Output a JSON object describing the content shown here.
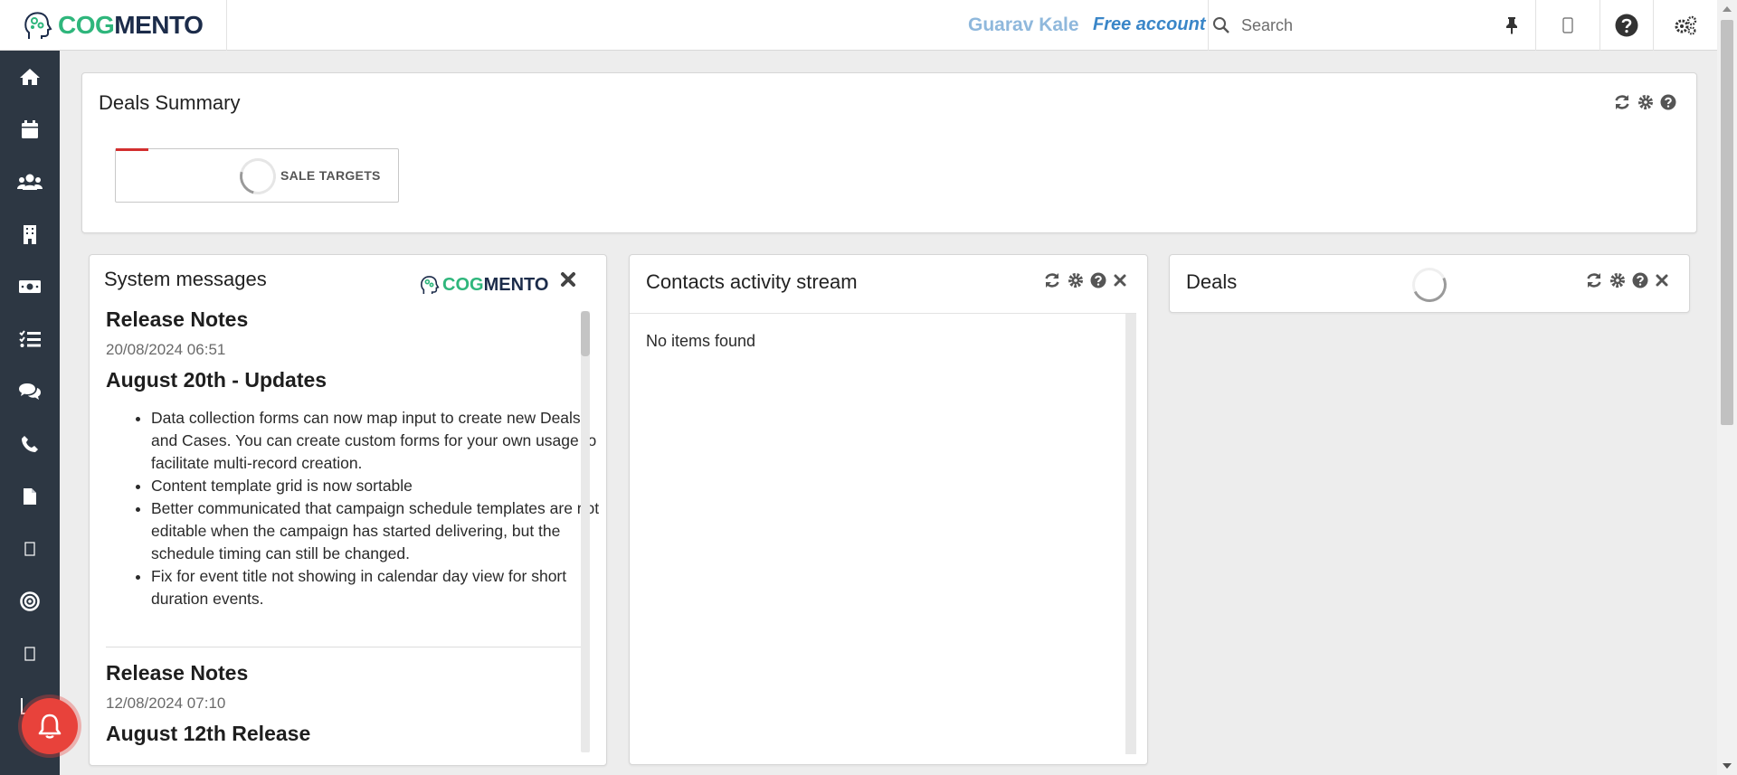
{
  "topbar": {
    "logo_cog": "COG",
    "logo_mento": "MENTO",
    "user_name": "Guarav Kale",
    "account_type": "Free account",
    "search_placeholder": "Search",
    "icons": [
      "pin-icon",
      "mobile-icon",
      "help-icon",
      "settings-gears-icon"
    ]
  },
  "sidebar": {
    "items": [
      "home-icon",
      "calendar-icon",
      "contacts-icon",
      "companies-icon",
      "deals-icon",
      "tasks-icon",
      "cases-icon",
      "calls-icon",
      "documents-icon",
      "email-icon",
      "campaigns-icon",
      "forms-icon",
      "reports-icon"
    ]
  },
  "deals_summary": {
    "title": "Deals Summary",
    "sale_targets_label": "SALE TARGETS",
    "icons": [
      "refresh-icon",
      "settings-icon",
      "help-icon"
    ]
  },
  "system_messages": {
    "title": "System messages",
    "logo_cog": "COG",
    "logo_mento": "MENTO",
    "messages": [
      {
        "title": "Release Notes",
        "date": "20/08/2024 06:51",
        "heading": "August 20th - Updates",
        "items": [
          "Data collection forms can now map input to create new Deals and Cases. You can create custom forms for your own usage to facilitate multi-record creation.",
          "Content template grid is now sortable",
          "Better communicated that campaign schedule templates are not editable when the campaign has started delivering, but the schedule timing can still be changed.",
          "Fix for event title not showing in calendar day view for short duration events."
        ]
      },
      {
        "title": "Release Notes",
        "date": "12/08/2024 07:10",
        "heading": "August 12th Release"
      }
    ]
  },
  "contacts_activity": {
    "title": "Contacts activity stream",
    "empty_text": "No items found",
    "icons": [
      "refresh-icon",
      "settings-icon",
      "help-icon",
      "close-icon"
    ]
  },
  "deals": {
    "title": "Deals",
    "icons": [
      "refresh-icon",
      "settings-icon",
      "help-icon",
      "close-icon"
    ]
  },
  "colors": {
    "sidebar_bg": "#2d3743",
    "brand_green": "#2fb67c",
    "brand_navy": "#1c2c4a",
    "user_name": "#8fb8dc",
    "account_link": "#3a86c8",
    "notification": "#e8423b"
  }
}
